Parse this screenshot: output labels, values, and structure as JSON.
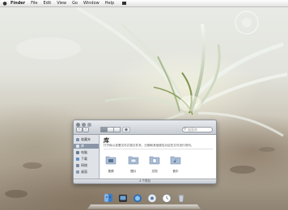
{
  "menubar": {
    "items": [
      "Finder",
      "File",
      "Edit",
      "View",
      "Go",
      "Window",
      "Help"
    ]
  },
  "window": {
    "library_title": "库",
    "library_description": "打开库以查看文件并按文件夹、日期和其他属性对这些文件进行排列。",
    "search_placeholder": "搜索库",
    "sidebar_items": [
      {
        "label": "收藏夹",
        "icon": "star-icon",
        "selected": false
      },
      {
        "label": "库",
        "icon": "library-icon",
        "selected": true
      },
      {
        "label": "电脑",
        "icon": "computer-icon",
        "selected": false
      },
      {
        "label": "下载",
        "icon": "download-icon",
        "selected": false
      },
      {
        "label": "网络",
        "icon": "network-icon",
        "selected": false
      },
      {
        "label": "桌面",
        "icon": "desktop-icon",
        "selected": false
      }
    ],
    "folders": [
      {
        "label": "视频",
        "icon": "folder-video-icon"
      },
      {
        "label": "图片",
        "icon": "folder-pictures-icon"
      },
      {
        "label": "文档",
        "icon": "folder-documents-icon"
      },
      {
        "label": "音乐",
        "icon": "folder-music-icon"
      }
    ],
    "status_text": "4 个项目"
  },
  "dock": {
    "items": [
      "finder-icon",
      "media-icon",
      "globe-icon",
      "settings-icon",
      "clock-icon",
      "trash-icon"
    ]
  },
  "colors": {
    "accent": "#7f8ea3",
    "sidebar_selected": "#8a96a6"
  }
}
